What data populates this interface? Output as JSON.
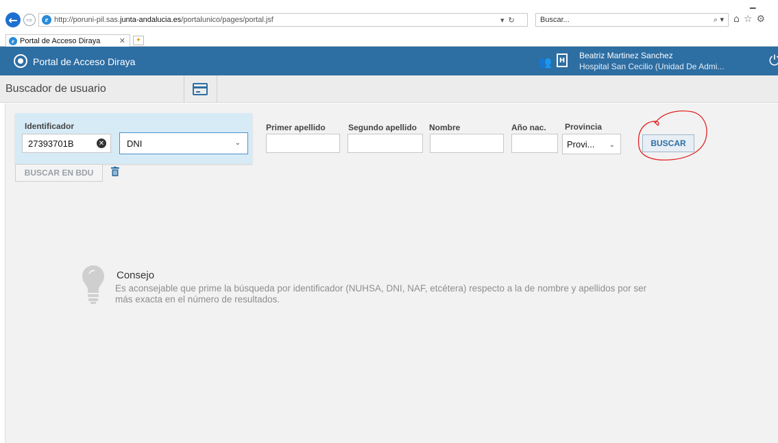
{
  "browser": {
    "url_prefix": "http://poruni-pil.sas.",
    "url_domain": "junta-andalucia.es",
    "url_path": "/portalunico/pages/portal.jsf",
    "search_placeholder": "Buscar...",
    "tab_title": "Portal de Acceso Diraya"
  },
  "header": {
    "title": "Portal de Acceso Diraya",
    "user_name": "Beatriz Martinez Sanchez",
    "user_unit": "Hospital San Cecilio (Unidad De Admi..."
  },
  "subheader": {
    "title": "Buscador de usuario"
  },
  "form": {
    "identificador_label": "Identificador",
    "identificador_value": "27393701B",
    "id_type_value": "DNI",
    "primer_apellido_label": "Primer apellido",
    "segundo_apellido_label": "Segundo apellido",
    "nombre_label": "Nombre",
    "anio_label": "Año nac.",
    "provincia_label": "Provincia",
    "provincia_value": "Provi...",
    "buscar_label": "BUSCAR",
    "buscar_bdu_label": "BUSCAR EN BDU"
  },
  "tip": {
    "title": "Consejo",
    "text": "Es aconsejable que prime la búsqueda por identificador (NUHSA, DNI, NAF, etcétera) respecto a la de nombre y apellidos por ser más exacta en el número de resultados."
  },
  "colors": {
    "header_blue": "#2d6ea3",
    "panel_blue": "#d7ebf6",
    "annotation_red": "#e02020"
  }
}
